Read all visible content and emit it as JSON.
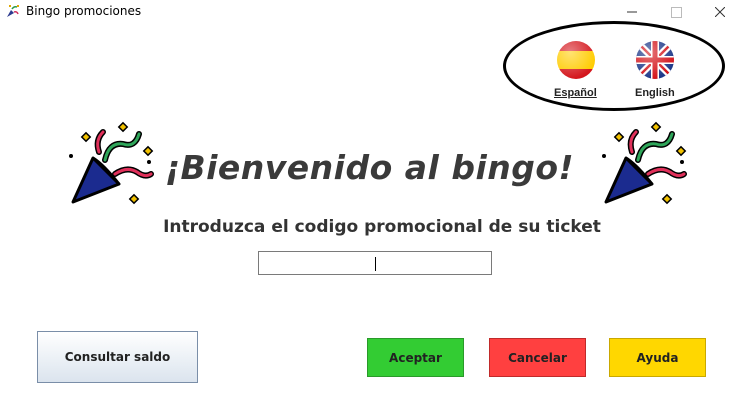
{
  "window": {
    "title": "Bingo promociones"
  },
  "languages": [
    {
      "name": "Español",
      "flag_icon": "spain-flag-icon"
    },
    {
      "name": "English",
      "flag_icon": "uk-flag-icon"
    }
  ],
  "main": {
    "welcome": "¡Bienvenido al bingo!",
    "prompt": "Introduzca el codigo promocional de su ticket",
    "code_value": "",
    "decoration_icon": "party-popper-icon"
  },
  "buttons": {
    "saldo": "Consultar saldo",
    "aceptar": "Aceptar",
    "cancelar": "Cancelar",
    "ayuda": "Ayuda"
  },
  "colors": {
    "aceptar": "#33cc33",
    "cancelar": "#ff4040",
    "ayuda": "#ffd700"
  }
}
